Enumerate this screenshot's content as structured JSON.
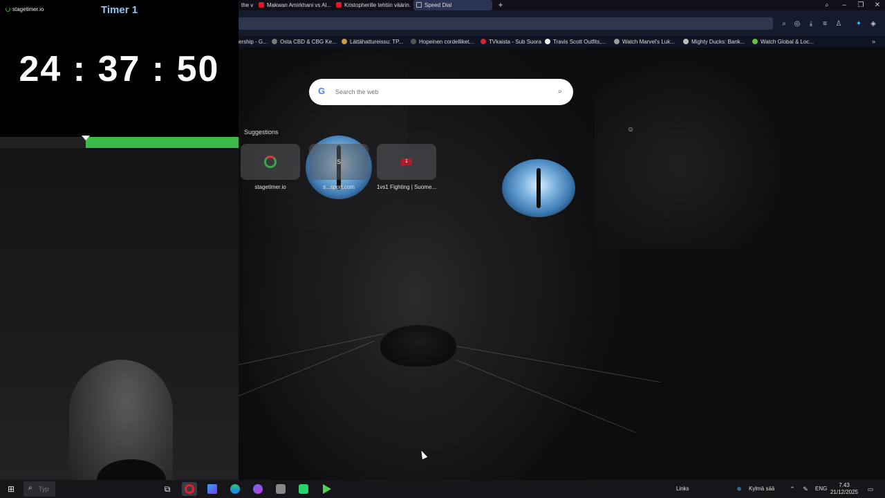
{
  "stagetimer": {
    "brand": "stagetimer.io",
    "title": "Timer 1",
    "time": "24 : 37 : 50",
    "progress_fraction": 0.64
  },
  "browser": {
    "tabs": [
      {
        "label": "the v",
        "active": false
      },
      {
        "label": "Makwan Amirkhani vs Al...",
        "active": false
      },
      {
        "label": "Kristopherille tehtiin väärin...",
        "active": false
      },
      {
        "label": "Speed Dial",
        "active": true
      }
    ],
    "bookmarks": [
      "ership - G...",
      "Osta CBD & CBG Ke...",
      "Lättähattureissu: TP...",
      "Hopeinen cordelliket...",
      "TVkaista - Sub Suora",
      "Travis Scott Outfits,...",
      "Watch Marvel's Luk...",
      "Mighty Ducks: Bank...",
      "Watch Global & Loc..."
    ],
    "icons": {
      "new_tab": "+",
      "more_bookmarks": "»"
    }
  },
  "speed_dial": {
    "search_placeholder": "Search the web",
    "suggestions_label": "Suggestions",
    "tiles": [
      {
        "label": "stagetimer.io",
        "icon_letter": ""
      },
      {
        "label": "s...sport.com",
        "icon_letter": "S"
      },
      {
        "label": "1vs1 Fighting | Suome...",
        "icon_letter": "1"
      }
    ]
  },
  "taskbar": {
    "search_text": "Typ",
    "links_label": "Links",
    "weather": "Kylmä sää",
    "language": "ENG",
    "time": "7.43",
    "date": "21/12/2025"
  },
  "colors": {
    "timer_title": "#8fc7ee",
    "progress": "#3cbb4a",
    "tab_active": "#2a3352"
  }
}
